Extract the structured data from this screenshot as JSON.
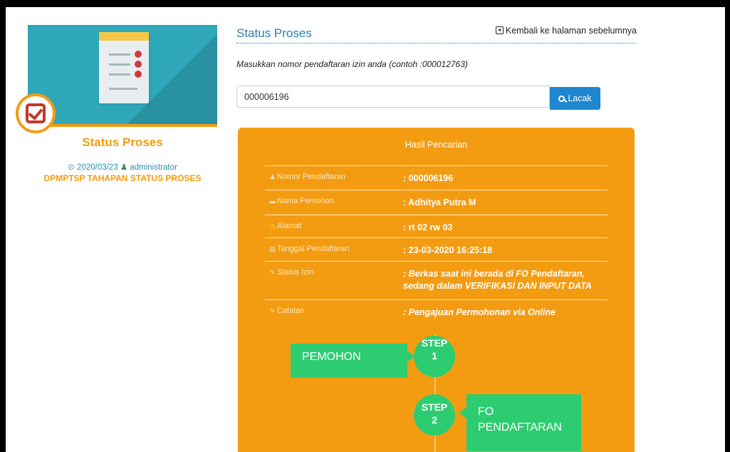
{
  "sidebar": {
    "title": "Status Proses",
    "date": "2020/03/23",
    "author": "administrator",
    "subtitle": "DPMPTSP TAHAPAN STATUS PROSES"
  },
  "main": {
    "title": "Status Proses",
    "back_link": "Kembali ke halaman sebelumnya",
    "hint": "Masukkan nomor pendaftaran izin anda (contoh :000012763)",
    "search_value": "000006196",
    "search_button": "Lacak"
  },
  "result": {
    "title": "Hasil Pencarian",
    "rows": [
      {
        "label": "Nomor Pendaftaran",
        "value": ": 000006196",
        "icon": "user-icon"
      },
      {
        "label": "Nama Pemohon",
        "value": ": Adhitya Putra M",
        "icon": "briefcase-icon"
      },
      {
        "label": "Alamat",
        "value": ": rt 02 rw 03",
        "icon": "home-icon"
      },
      {
        "label": "Tanggal Pendaftaran",
        "value": ": 23-03-2020 16:25:18",
        "icon": "calendar-icon"
      },
      {
        "label": "Status Izin",
        "value": ": Berkas saat ini berada di FO Pendaftaran, sedang dalam VERIFIKASI DAN INPUT DATA",
        "icon": "pencil-icon"
      },
      {
        "label": "Catatan",
        "value": ": Pengajuan Permohonan via Online",
        "icon": "pencil-icon"
      }
    ]
  },
  "flow": {
    "step_word": "STEP",
    "steps": [
      {
        "number": "1",
        "label": "PEMOHON"
      },
      {
        "number": "2",
        "label": "FO PENDAFTARAN"
      }
    ]
  },
  "colors": {
    "accent": "#f39c12",
    "primary": "#2a7fb4",
    "button": "#1f87d0",
    "step": "#2ecc71",
    "hero": "#2ea7b9"
  }
}
